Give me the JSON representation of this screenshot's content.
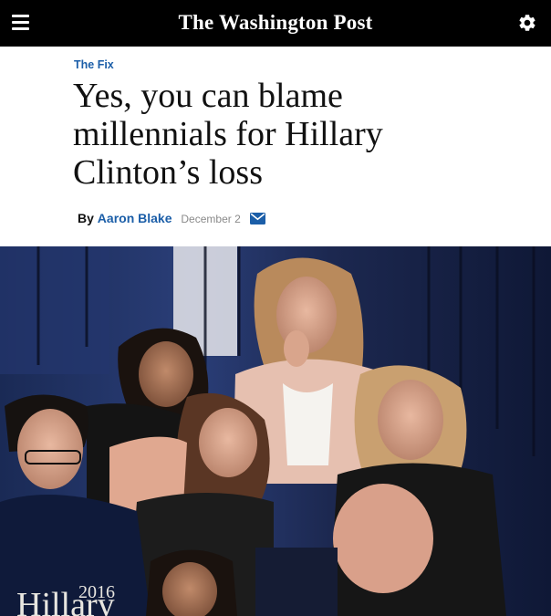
{
  "header": {
    "masthead": "The Washington Post",
    "menu_icon": "hamburger-menu-icon",
    "settings_icon": "gear-icon",
    "background": "#000000"
  },
  "article": {
    "section": "The Fix",
    "headline": "Yes, you can blame millennials for Hillary Clinton’s loss",
    "byline_prefix": "By",
    "author": "Aaron Blake",
    "date": "December 2",
    "email_icon": "envelope-icon",
    "link_color": "#1b5ea8"
  },
  "photo": {
    "shirt_text_year": "2016",
    "shirt_text_name": "Hillary"
  }
}
